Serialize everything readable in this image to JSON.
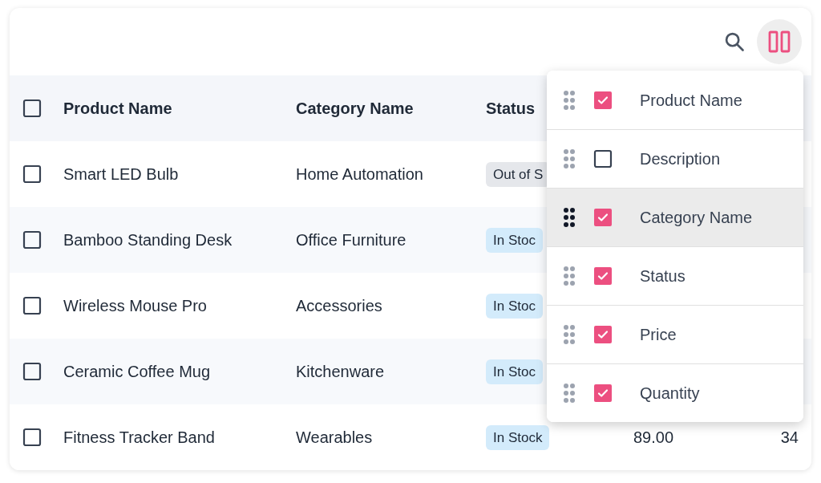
{
  "toolbar": {
    "columns_button": {
      "active": true
    }
  },
  "table": {
    "columns": [
      {
        "label": "Product Name"
      },
      {
        "label": "Category Name"
      },
      {
        "label": "Status"
      }
    ],
    "header_checkbox": {
      "checked": false
    },
    "rows": [
      {
        "checked": false,
        "product": "Smart LED Bulb",
        "category": "Home Automation",
        "status": {
          "label": "Out of S",
          "kind": "out"
        }
      },
      {
        "checked": false,
        "product": "Bamboo Standing Desk",
        "category": "Office Furniture",
        "status": {
          "label": "In Stoc",
          "kind": "in"
        }
      },
      {
        "checked": false,
        "product": "Wireless Mouse Pro",
        "category": "Accessories",
        "status": {
          "label": "In Stoc",
          "kind": "in"
        }
      },
      {
        "checked": false,
        "product": "Ceramic Coffee Mug",
        "category": "Kitchenware",
        "status": {
          "label": "In Stoc",
          "kind": "in"
        }
      },
      {
        "checked": false,
        "product": "Fitness Tracker Band",
        "category": "Wearables",
        "status": {
          "label": "In Stock",
          "kind": "in"
        },
        "price": "89.00",
        "quantity": "34"
      }
    ]
  },
  "column_menu": {
    "items": [
      {
        "label": "Product Name",
        "checked": true,
        "highlighted": false
      },
      {
        "label": "Description",
        "checked": false,
        "highlighted": false
      },
      {
        "label": "Category Name",
        "checked": true,
        "highlighted": true
      },
      {
        "label": "Status",
        "checked": true,
        "highlighted": false
      },
      {
        "label": "Price",
        "checked": true,
        "highlighted": false
      },
      {
        "label": "Quantity",
        "checked": true,
        "highlighted": false
      }
    ]
  }
}
